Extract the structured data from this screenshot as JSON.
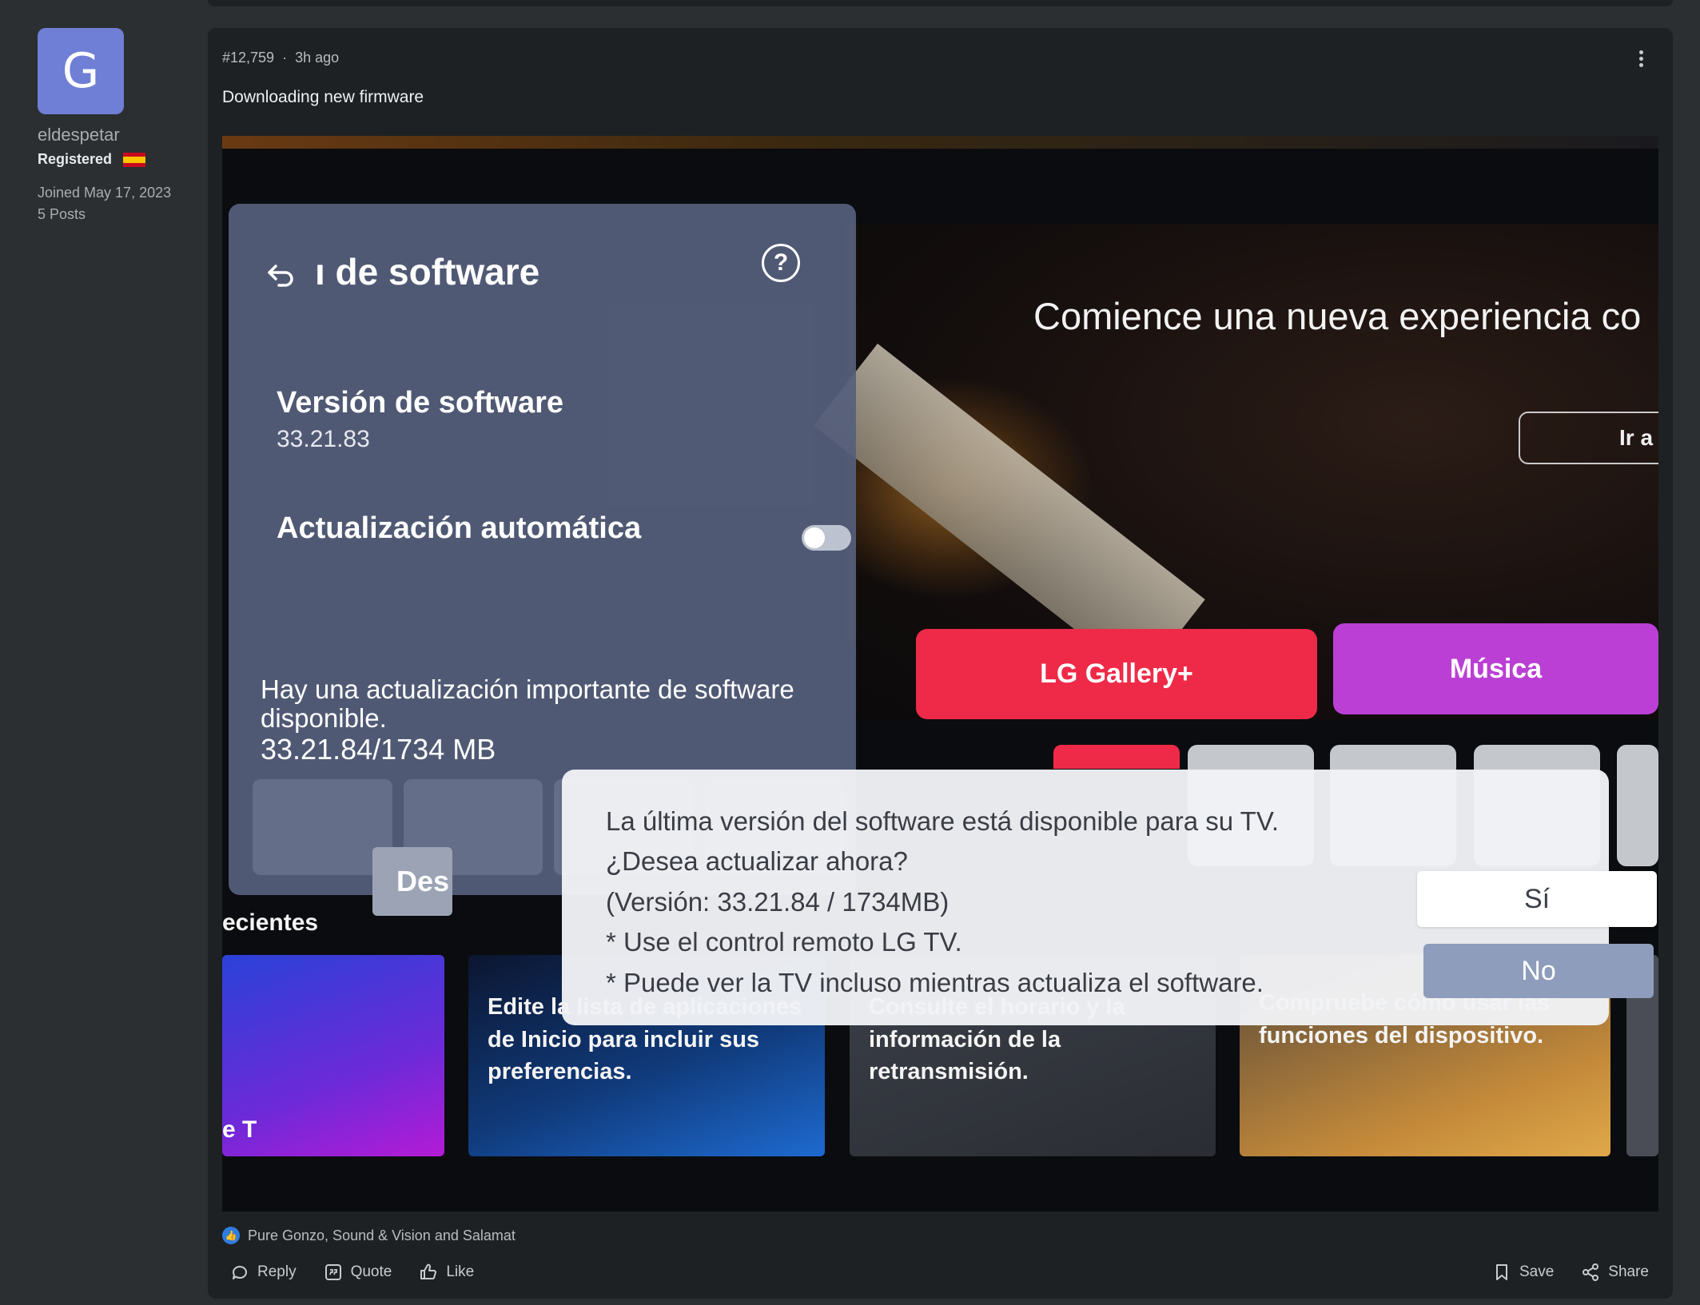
{
  "user": {
    "avatar_letter": "G",
    "username": "eldespetar",
    "role": "Registered",
    "flag": "spain-flag-icon",
    "joined": "Joined May 17, 2023",
    "posts": "5 Posts"
  },
  "post": {
    "number": "#12,759",
    "separator": "·",
    "time": "3h ago",
    "text": "Downloading new firmware"
  },
  "tv": {
    "hero_title": "Comience una nueva experiencia co",
    "hero_button": "Ir a",
    "tile_gallery": "LG Gallery+",
    "tile_music": "Música",
    "row_label": "ecientes",
    "card1_tag": "e T",
    "card2_text": "Edite la lista de aplicaciones de Inicio para incluir sus preferencias.",
    "card3_text": "Consulte el horario y la información de la retransmisión.",
    "card4_text": "Compruebe cómo usar las funciones del dispositivo.",
    "panel": {
      "title": "ı de software",
      "version_label": "Versión de software",
      "version_value": "33.21.83",
      "auto_update_label": "Actualización automática",
      "notice_line1": "Hay una actualización importante de software disponible.",
      "notice_line2": "33.21.84/1734 MB",
      "des_button": "Des"
    },
    "dialog": {
      "line1": "La última versión del software está disponible para su TV.",
      "line2": "¿Desea actualizar ahora?",
      "line3": "(Versión: 33.21.84 / 1734MB)",
      "line4": "* Use el control remoto LG TV.",
      "line5": "* Puede ver la TV incluso mientras actualiza el software.",
      "yes": "Sí",
      "no": "No"
    }
  },
  "reactions": {
    "text": "Pure Gonzo, Sound & Vision and Salamat"
  },
  "actions": {
    "reply": "Reply",
    "quote": "Quote",
    "like": "Like",
    "save": "Save",
    "share": "Share"
  }
}
